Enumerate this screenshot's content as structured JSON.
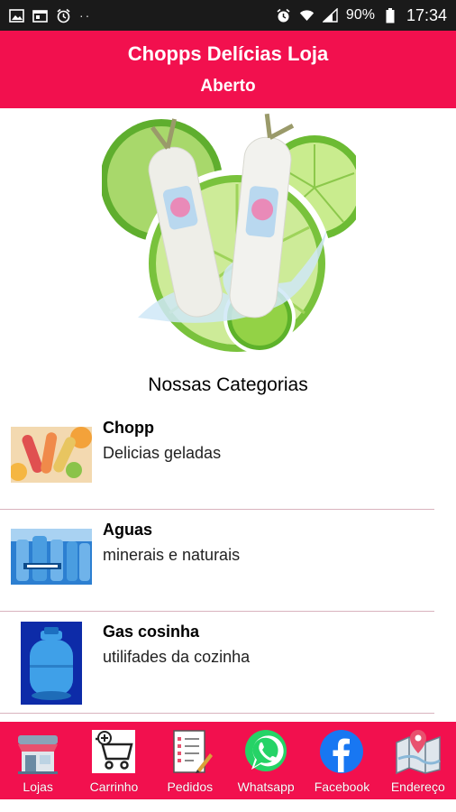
{
  "status_bar": {
    "battery": "90%",
    "time": "17:34",
    "dots": "··"
  },
  "header": {
    "title": "Chopps Delícias Loja",
    "status": "Aberto"
  },
  "section_title": "Nossas Categorias",
  "categories": [
    {
      "name": "Chopp",
      "description": "Delicias geladas",
      "icon": "chopp-thumbnail"
    },
    {
      "name": "Aguas",
      "description": "minerais e naturais",
      "icon": "water-thumbnail"
    },
    {
      "name": "Gas cosinha",
      "description": "utilifades da cozinha",
      "icon": "gas-cylinder-thumbnail"
    }
  ],
  "bottom_nav": [
    {
      "label": "Lojas",
      "icon": "store-icon"
    },
    {
      "label": "Carrinho",
      "icon": "cart-icon"
    },
    {
      "label": "Pedidos",
      "icon": "orders-icon"
    },
    {
      "label": "Whatsapp",
      "icon": "whatsapp-icon"
    },
    {
      "label": "Facebook",
      "icon": "facebook-icon"
    },
    {
      "label": "Endereço",
      "icon": "map-icon"
    }
  ],
  "colors": {
    "brand": "#f2104e",
    "status_bar": "#1a1a1a",
    "lime": "#7bc142",
    "whatsapp": "#25d366",
    "facebook": "#1877f2"
  }
}
